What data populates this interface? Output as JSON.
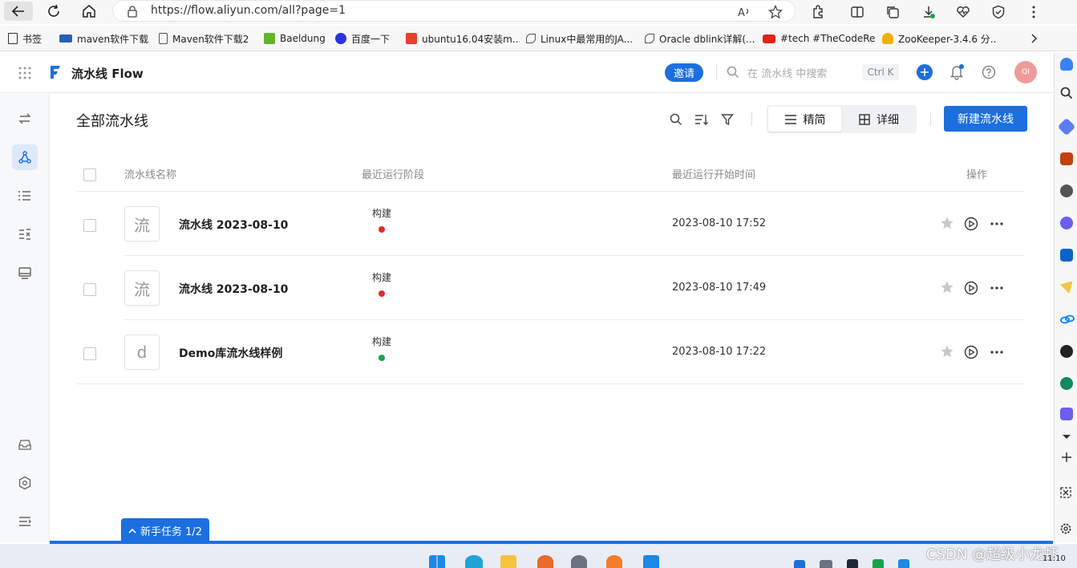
{
  "browser": {
    "url": "https://flow.aliyun.com/all?page=1",
    "bookmarks": [
      {
        "label": "书签",
        "color": "#333333"
      },
      {
        "label": "maven软件下载",
        "color": "#2b5fb4"
      },
      {
        "label": "Maven软件下载2",
        "color": "#555555"
      },
      {
        "label": "Baeldung",
        "color": "#63b32e"
      },
      {
        "label": "百度一下",
        "color": "#2932e1"
      },
      {
        "label": "ubuntu16.04安装m...",
        "color": "#e5412b"
      },
      {
        "label": "Linux中最常用的JA...",
        "color": "#555555"
      },
      {
        "label": "Oracle dblink详解(...",
        "color": "#555555"
      },
      {
        "label": "#tech #TheCodeRe...",
        "color": "#e62117"
      },
      {
        "label": "ZooKeeper-3.4.6 分...",
        "color": "#f2b100"
      }
    ]
  },
  "header": {
    "logo_letter": "F",
    "product_name": "流水线 Flow",
    "invite_label": "邀请",
    "search_placeholder": "在 流水线 中搜索",
    "shortcut": "Ctrl K",
    "avatar_text": "QI"
  },
  "page": {
    "title": "全部流水线",
    "view_compact": "精简",
    "view_detail": "详细",
    "new_button": "新建流水线",
    "columns": {
      "name": "流水线名称",
      "stage": "最近运行阶段",
      "time": "最近运行开始时间",
      "actions": "操作"
    },
    "rows": [
      {
        "avatar": "流",
        "name": "流水线 2023-08-10",
        "stage": "构建",
        "status_color": "#e02d2d",
        "time": "2023-08-10 17:52"
      },
      {
        "avatar": "流",
        "name": "流水线 2023-08-10",
        "stage": "构建",
        "status_color": "#e02d2d",
        "time": "2023-08-10 17:49"
      },
      {
        "avatar": "d",
        "name": "Demo库流水线样例",
        "stage": "构建",
        "status_color": "#1aa34a",
        "time": "2023-08-10 17:22"
      }
    ],
    "guide_label": "新手任务 1/2"
  },
  "colors": {
    "accent": "#1b6fe0"
  },
  "taskbar": {
    "clock": "11:10"
  },
  "watermark": "CSDN @超级小龙虾"
}
